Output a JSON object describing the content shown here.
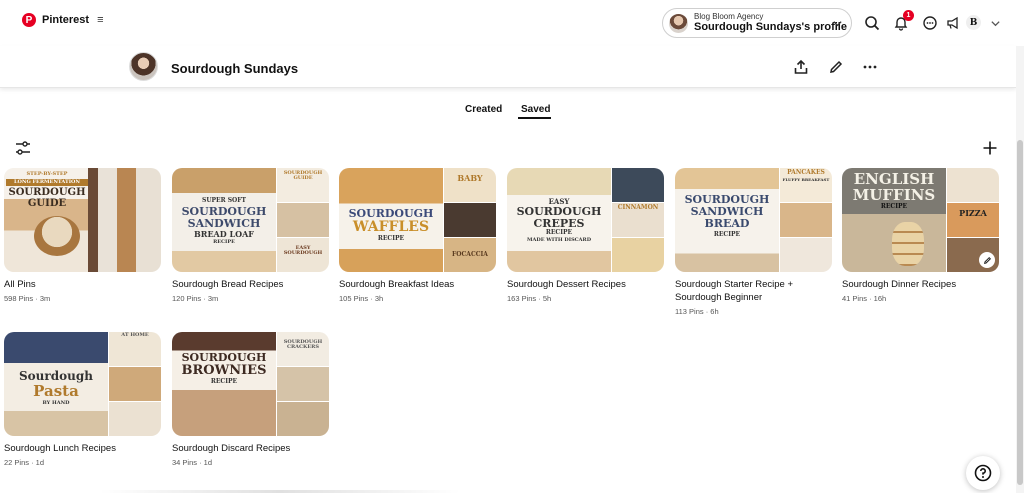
{
  "nav": {
    "brand": "Pinterest",
    "brand_logo_letter": "P",
    "menu_icon": "hamburger-icon",
    "account_label": "Blog Bloom Agency",
    "profile_label": "Sourdough Sundays's profile",
    "notifications_count": "1",
    "user_initial": "B"
  },
  "board": {
    "title": "Sourdough Sundays"
  },
  "tabs": [
    "Created",
    "Saved"
  ],
  "active_tab": "Saved",
  "boards": [
    {
      "title": "All Pins",
      "meta": "598 Pins · 3m",
      "banner_lines": [
        "STEP-BY-STEP",
        "LONG FERMENTATION",
        "SOURDOUGH",
        "GUIDE"
      ],
      "banner_color": "#b07a2c"
    },
    {
      "title": "Sourdough Bread Recipes",
      "meta": "120 Pins · 3m",
      "banner_lines": [
        "SUPER SOFT",
        "SOURDOUGH",
        "SANDWICH",
        "BREAD LOAF",
        "RECIPE"
      ],
      "banner_color": "#3d4a6b",
      "side_labels": [
        "SOURDOUGH GUIDE",
        "EASY SOURDOUGH"
      ]
    },
    {
      "title": "Sourdough Breakfast Ideas",
      "meta": "105 Pins · 3h",
      "banner_lines": [
        "SOURDOUGH",
        "WAFFLES",
        "RECIPE"
      ],
      "banner_color": "#3b4a7a",
      "side_labels": [
        "BABY",
        "FOCACCIA"
      ]
    },
    {
      "title": "Sourdough Dessert Recipes",
      "meta": "163 Pins · 5h",
      "banner_lines": [
        "EASY",
        "SOURDOUGH",
        "CREPES",
        "RECIPE",
        "MADE WITH DISCARD"
      ],
      "banner_color": "#3a3a3a",
      "side_labels": [
        "CINNAMON"
      ]
    },
    {
      "title": "Sourdough Starter Recipe + Sourdough Beginner",
      "meta": "113 Pins · 6h",
      "banner_lines": [
        "SOURDOUGH",
        "SANDWICH",
        "BREAD",
        "RECIPE"
      ],
      "banner_color": "#3a4a6e",
      "side_labels": [
        "PANCAKES",
        "FLUFFY BREAKFAST"
      ]
    },
    {
      "title": "Sourdough Dinner Recipes",
      "meta": "41 Pins · 16h",
      "banner_lines": [
        "ENGLISH",
        "MUFFINS",
        "RECIPE"
      ],
      "banner_color": "#f4f1e6",
      "side_labels": [
        "PIZZA"
      ]
    },
    {
      "title": "Sourdough Lunch Recipes",
      "meta": "22 Pins · 1d",
      "banner_lines": [
        "Sourdough",
        "Pasta",
        "BY HAND"
      ],
      "banner_color": "#3a4a6e",
      "side_labels": [
        "AT HOME"
      ]
    },
    {
      "title": "Sourdough Discard Recipes",
      "meta": "34 Pins · 1d",
      "banner_lines": [
        "SOURDOUGH",
        "BROWNIES",
        "RECIPE"
      ],
      "banner_color": "#3d2a22",
      "side_labels": [
        "SOURDOUGH CRACKERS"
      ]
    }
  ],
  "colors": {
    "brand_red": "#e60023",
    "text_primary": "#111111",
    "text_meta": "#555555"
  }
}
